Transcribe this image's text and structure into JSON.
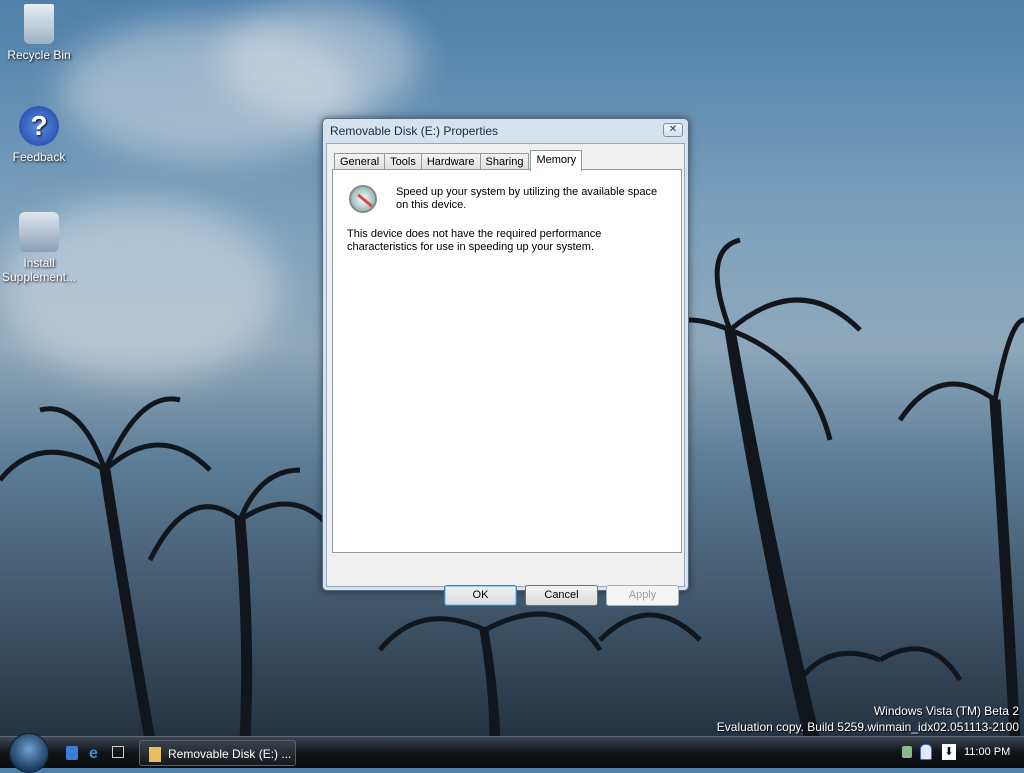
{
  "desktop": {
    "icons": [
      {
        "label": "Recycle Bin"
      },
      {
        "label": "Feedback"
      },
      {
        "label": "Install Supplement..."
      }
    ],
    "watermark": [
      "Windows Vista (TM) Beta 2",
      "Evaluation copy. Build 5259.winmain_idx02.051113-2100"
    ]
  },
  "dialog": {
    "title": "Removable Disk (E:) Properties",
    "close": "✕",
    "tabs": [
      "General",
      "Tools",
      "Hardware",
      "Sharing",
      "Memory"
    ],
    "active_tab": "Memory",
    "intro": "Speed up your system by utilizing the available space on this device.",
    "message": "This device does not have the required performance characteristics for use in speeding up your system.",
    "buttons": {
      "ok": "OK",
      "cancel": "Cancel",
      "apply": "Apply"
    }
  },
  "taskbar": {
    "task": "Removable Disk (E:) ...",
    "clock": "11:00 PM"
  }
}
